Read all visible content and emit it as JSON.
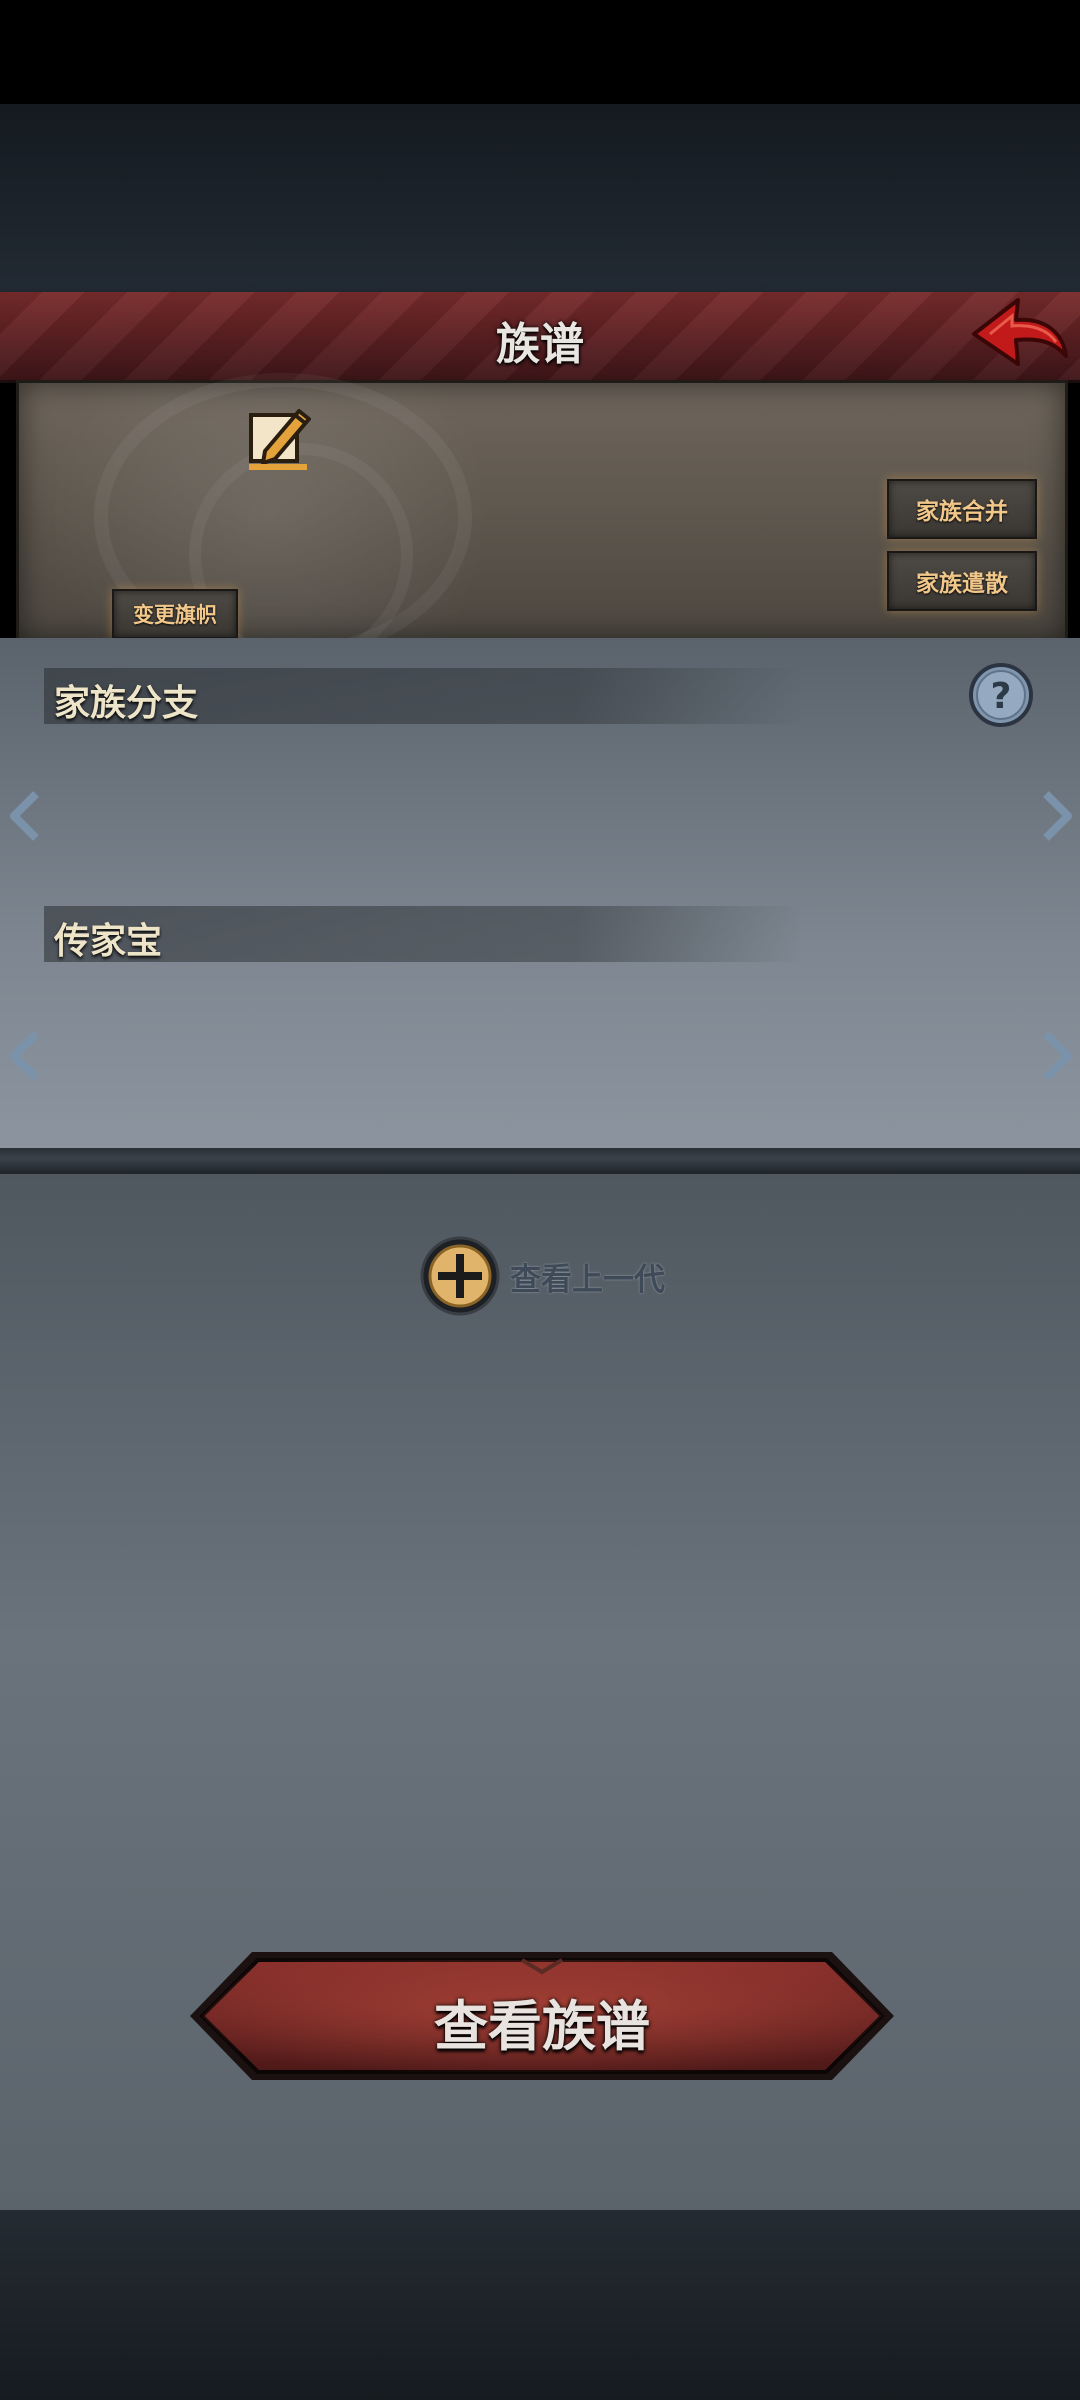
{
  "header": {
    "title": "族谱",
    "back_icon": "back-arrow-icon"
  },
  "banner": {
    "edit_icon": "edit-pencil-icon",
    "merge_label": "家族合并",
    "disband_label": "家族遣散",
    "change_flag_label": "变更旗帜"
  },
  "sections": {
    "branches": {
      "title": "家族分支",
      "help_icon": "question-mark-icon"
    },
    "heirloom": {
      "title": "传家宝"
    }
  },
  "tree": {
    "prev_gen_icon": "plus-circle-icon",
    "prev_gen_label": "查看上一代",
    "view_tree_label": "查看族谱"
  },
  "colors": {
    "title_bar": "#5a1f22",
    "accent_gold": "#f2c78a",
    "button_red": "#7a2a28"
  }
}
